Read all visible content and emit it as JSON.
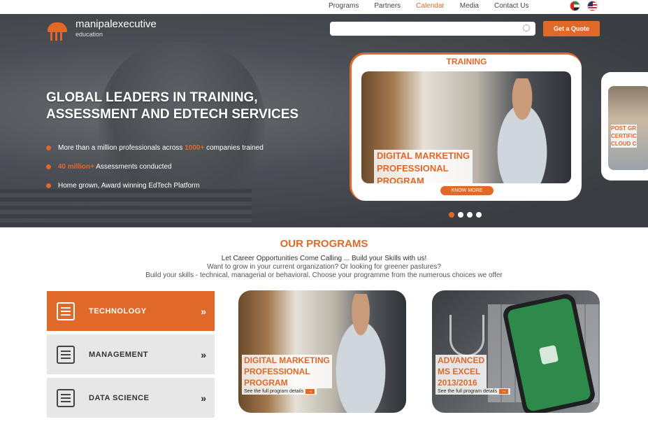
{
  "topnav": {
    "links": [
      "Programs",
      "Partners",
      "Calendar",
      "Media",
      "Contact Us"
    ],
    "active": "Calendar"
  },
  "header": {
    "brand": "manipalexecutive",
    "brand_sub": "education",
    "search_placeholder": "",
    "cta_label": "Get a Quote"
  },
  "hero": {
    "headline_line1": "GLOBAL LEADERS IN TRAINING,",
    "headline_line2": "ASSESSMENT AND EDTECH SERVICES",
    "bullets": [
      {
        "pre": "More than a million professionals across ",
        "hl": "1000+",
        "post": " companies trained"
      },
      {
        "pre": "",
        "hl": "40 million+",
        "post": " Assessments conducted"
      },
      {
        "pre": "Home grown, Award winning EdTech Platform",
        "hl": "",
        "post": ""
      }
    ]
  },
  "slider": {
    "card_label": "TRAINING",
    "card_program_l1": "DIGITAL MARKETING",
    "card_program_l2": "PROFESSIONAL",
    "card_program_l3": "PROGRAM",
    "card_button": "KNOW MORE",
    "next_program_l1": "POST GR",
    "next_program_l2": "CERTIFIC",
    "next_program_l3": "CLOUD C",
    "active_dot": 0,
    "dot_count": 4
  },
  "programs": {
    "title": "OUR PROGRAMS",
    "line1": "Let Career Opportunities Come Calling ... Build your Skills with us!",
    "line2": "Want to grow in your current organization? Or looking for greener pastures?",
    "line3": "Build your skills - technical, managerial or behavioral. Choose your programme from the numerous choices we offer",
    "categories": [
      {
        "label": "TECHNOLOGY",
        "icon": "server-icon",
        "active": true
      },
      {
        "label": "MANAGEMENT",
        "icon": "chart-icon",
        "active": false
      },
      {
        "label": "DATA SCIENCE",
        "icon": "data-icon",
        "active": false
      }
    ],
    "cards": [
      {
        "l1": "DIGITAL MARKETING",
        "l2": "PROFESSIONAL",
        "l3": "PROGRAM",
        "more": "See the full program details"
      },
      {
        "l1": "ADVANCED",
        "l2": "MS EXCEL",
        "l3": "2013/2016",
        "more": "See the full program details"
      }
    ]
  },
  "colors": {
    "accent": "#e0692a",
    "hero_bg": "#45484d"
  }
}
